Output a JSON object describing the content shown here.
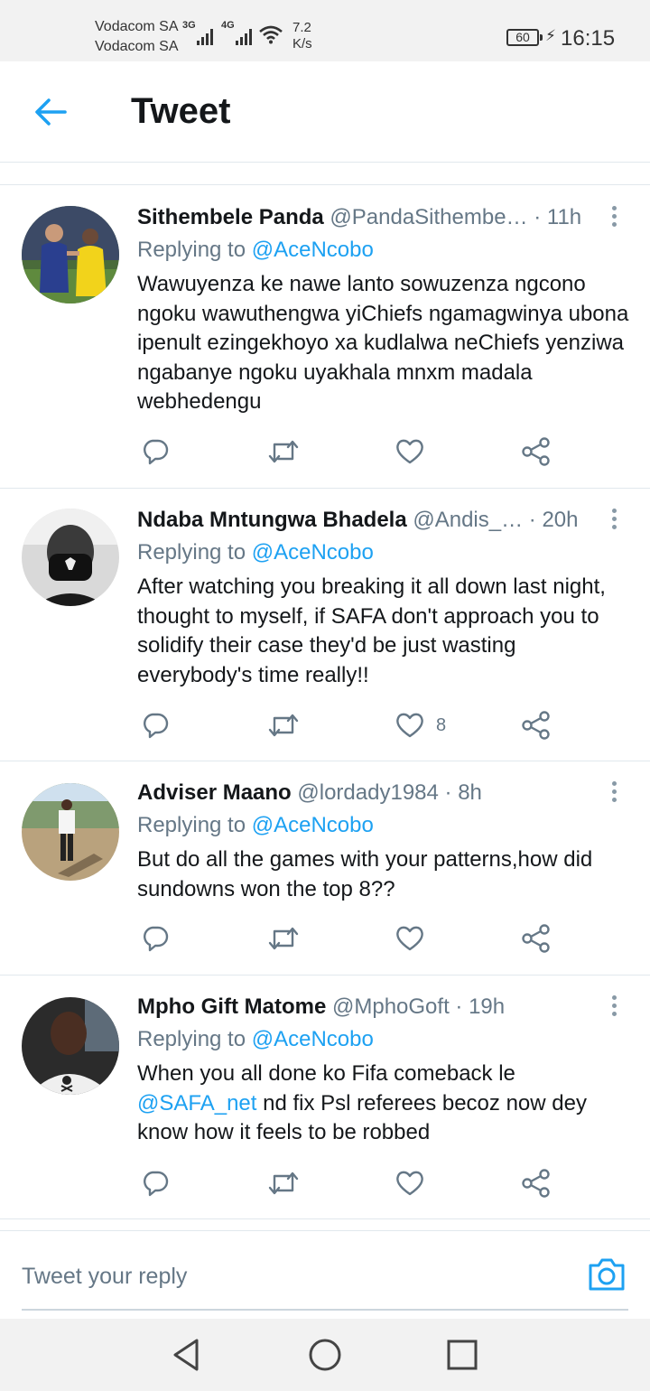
{
  "status_bar": {
    "carrier1": "Vodacom SA",
    "carrier2": "Vodacom SA",
    "net1": "3G",
    "net2": "4G",
    "speed_value": "7.2",
    "speed_unit": "K/s",
    "battery": "60",
    "time": "16:15"
  },
  "header": {
    "title": "Tweet"
  },
  "tweets": [
    {
      "name": "Sithembele Panda",
      "handle": "@PandaSithembe…",
      "time": "· 11h",
      "replying_prefix": "Replying to",
      "replying_to": "@AceNcobo",
      "text": "Wawuyenza ke nawe lanto sowuzenza ngcono ngoku wawuthengwa yiChiefs ngamagwinya ubona ipenult ezingekhoyo xa kudlalwa neChiefs yenziwa ngabanye ngoku uyakhala mnxm madala webhedengu",
      "likes": ""
    },
    {
      "name": "Ndaba Mntungwa Bhadela",
      "handle": "@Andis_…",
      "time": "· 20h",
      "replying_prefix": "Replying to",
      "replying_to": "@AceNcobo",
      "text": "After watching you breaking it all down last night, thought to myself, if SAFA don't approach you to solidify their case they'd be just wasting everybody's time really!!",
      "likes": "8"
    },
    {
      "name": "Adviser Maano",
      "handle": "@lordady1984",
      "time": "· 8h",
      "replying_prefix": "Replying to",
      "replying_to": "@AceNcobo",
      "text": "But do all the games with your patterns,how did sundowns won the top 8??",
      "likes": ""
    },
    {
      "name": "Mpho Gift Matome",
      "handle": "@MphoGoft",
      "time": "· 19h",
      "replying_prefix": "Replying to",
      "replying_to": "@AceNcobo",
      "text_before": "When you all done ko Fifa comeback le ",
      "text_mention": "@SAFA_net",
      "text_after": " nd fix Psl referees becoz now dey know how it feels to be robbed",
      "likes": ""
    }
  ],
  "reply_bar": {
    "placeholder": "Tweet your reply"
  },
  "colors": {
    "accent": "#1da1f2",
    "secondary_text": "#657786",
    "divider": "#e1e8ed"
  }
}
